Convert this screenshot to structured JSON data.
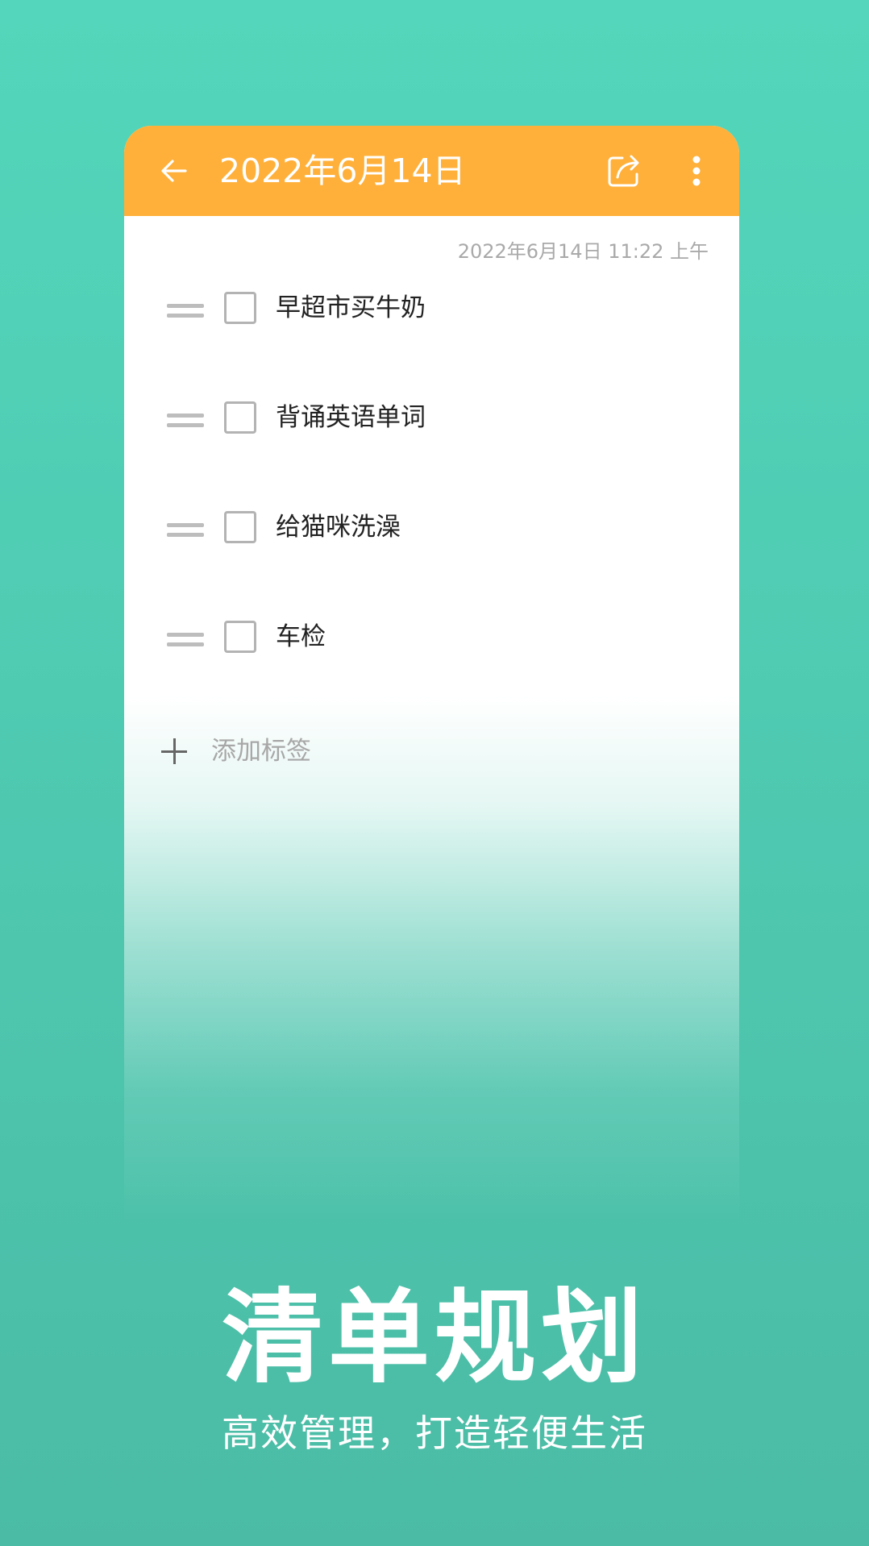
{
  "app": {
    "title": "2022年6月14日",
    "timestamp": "2022年6月14日 11:22 上午",
    "header_color": "#ffb03a",
    "icons": {
      "back": "arrow-left-icon",
      "share": "share-icon",
      "more": "more-vertical-icon"
    }
  },
  "todos": [
    {
      "text": "早超市买牛奶",
      "checked": false
    },
    {
      "text": "背诵英语单词",
      "checked": false
    },
    {
      "text": "给猫咪洗澡",
      "checked": false
    },
    {
      "text": "车检",
      "checked": false
    }
  ],
  "add_tag": {
    "label": "添加标签",
    "icon": "plus-icon"
  },
  "promo": {
    "headline": "清单规划",
    "subhead": "高效管理，打造轻便生活",
    "background_color": "#50ccb3"
  }
}
